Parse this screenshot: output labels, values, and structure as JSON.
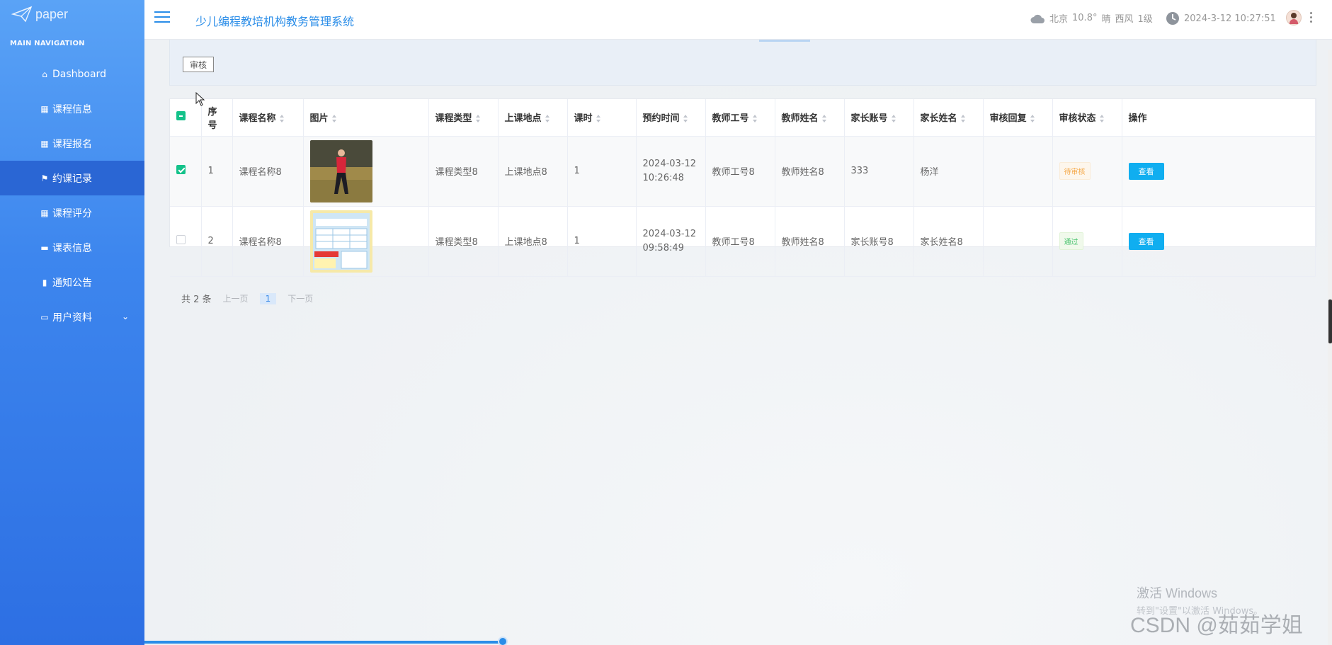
{
  "sidebar": {
    "logo_text": "paper",
    "heading": "MAIN NAVIGATION",
    "items": [
      {
        "label": "Dashboard",
        "icon": "home-icon"
      },
      {
        "label": "课程信息",
        "icon": "grid-icon"
      },
      {
        "label": "课程报名",
        "icon": "grid-icon"
      },
      {
        "label": "约课记录",
        "icon": "flag-icon",
        "active": true
      },
      {
        "label": "课程评分",
        "icon": "grid-icon"
      },
      {
        "label": "课表信息",
        "icon": "briefcase-icon"
      },
      {
        "label": "通知公告",
        "icon": "clipboard-icon"
      },
      {
        "label": "用户资料",
        "icon": "card-icon",
        "expandable": true
      }
    ]
  },
  "header": {
    "title": "少儿编程教培机构教务管理系统",
    "weather": {
      "city": "北京",
      "temp": "10.8°",
      "condition": "晴",
      "wind": "西风",
      "level": "1级"
    },
    "datetime": "2024-3-12 10:27:51"
  },
  "toolbar": {
    "audit_label": "审核"
  },
  "table": {
    "columns": [
      "序号",
      "课程名称",
      "图片",
      "课程类型",
      "上课地点",
      "课时",
      "预约时间",
      "教师工号",
      "教师姓名",
      "家长账号",
      "家长姓名",
      "审核回复",
      "审核状态",
      "操作"
    ],
    "rows": [
      {
        "checked": true,
        "index": "1",
        "course_name": "课程名称8",
        "image": "runner-photo",
        "course_type": "课程类型8",
        "location": "上课地点8",
        "hours": "1",
        "date": "2024-03-12",
        "time": "10:26:48",
        "teacher_id": "教师工号8",
        "teacher_name": "教师姓名8",
        "parent_account": "333",
        "parent_name": "杨洋",
        "reply": "",
        "status": "待审核",
        "status_kind": "pending",
        "action": "查看"
      },
      {
        "checked": false,
        "index": "2",
        "course_name": "课程名称8",
        "image": "schedule-poster",
        "course_type": "课程类型8",
        "location": "上课地点8",
        "hours": "1",
        "date": "2024-03-12",
        "time": "09:58:49",
        "teacher_id": "教师工号8",
        "teacher_name": "教师姓名8",
        "parent_account": "家长账号8",
        "parent_name": "家长姓名8",
        "reply": "",
        "status": "通过",
        "status_kind": "passed",
        "action": "查看"
      }
    ]
  },
  "pagination": {
    "total": "共 2 条",
    "prev": "上一页",
    "current": "1",
    "next": "下一页"
  },
  "watermark": {
    "windows_title": "激活 Windows",
    "windows_sub": "转到\"设置\"以激活 Windows。",
    "csdn": "CSDN @茹茹学姐"
  },
  "colors": {
    "accent": "#2a8de8",
    "sidebar_active": "#2a66d4",
    "check": "#14c28a",
    "view_button": "#10aef0"
  }
}
